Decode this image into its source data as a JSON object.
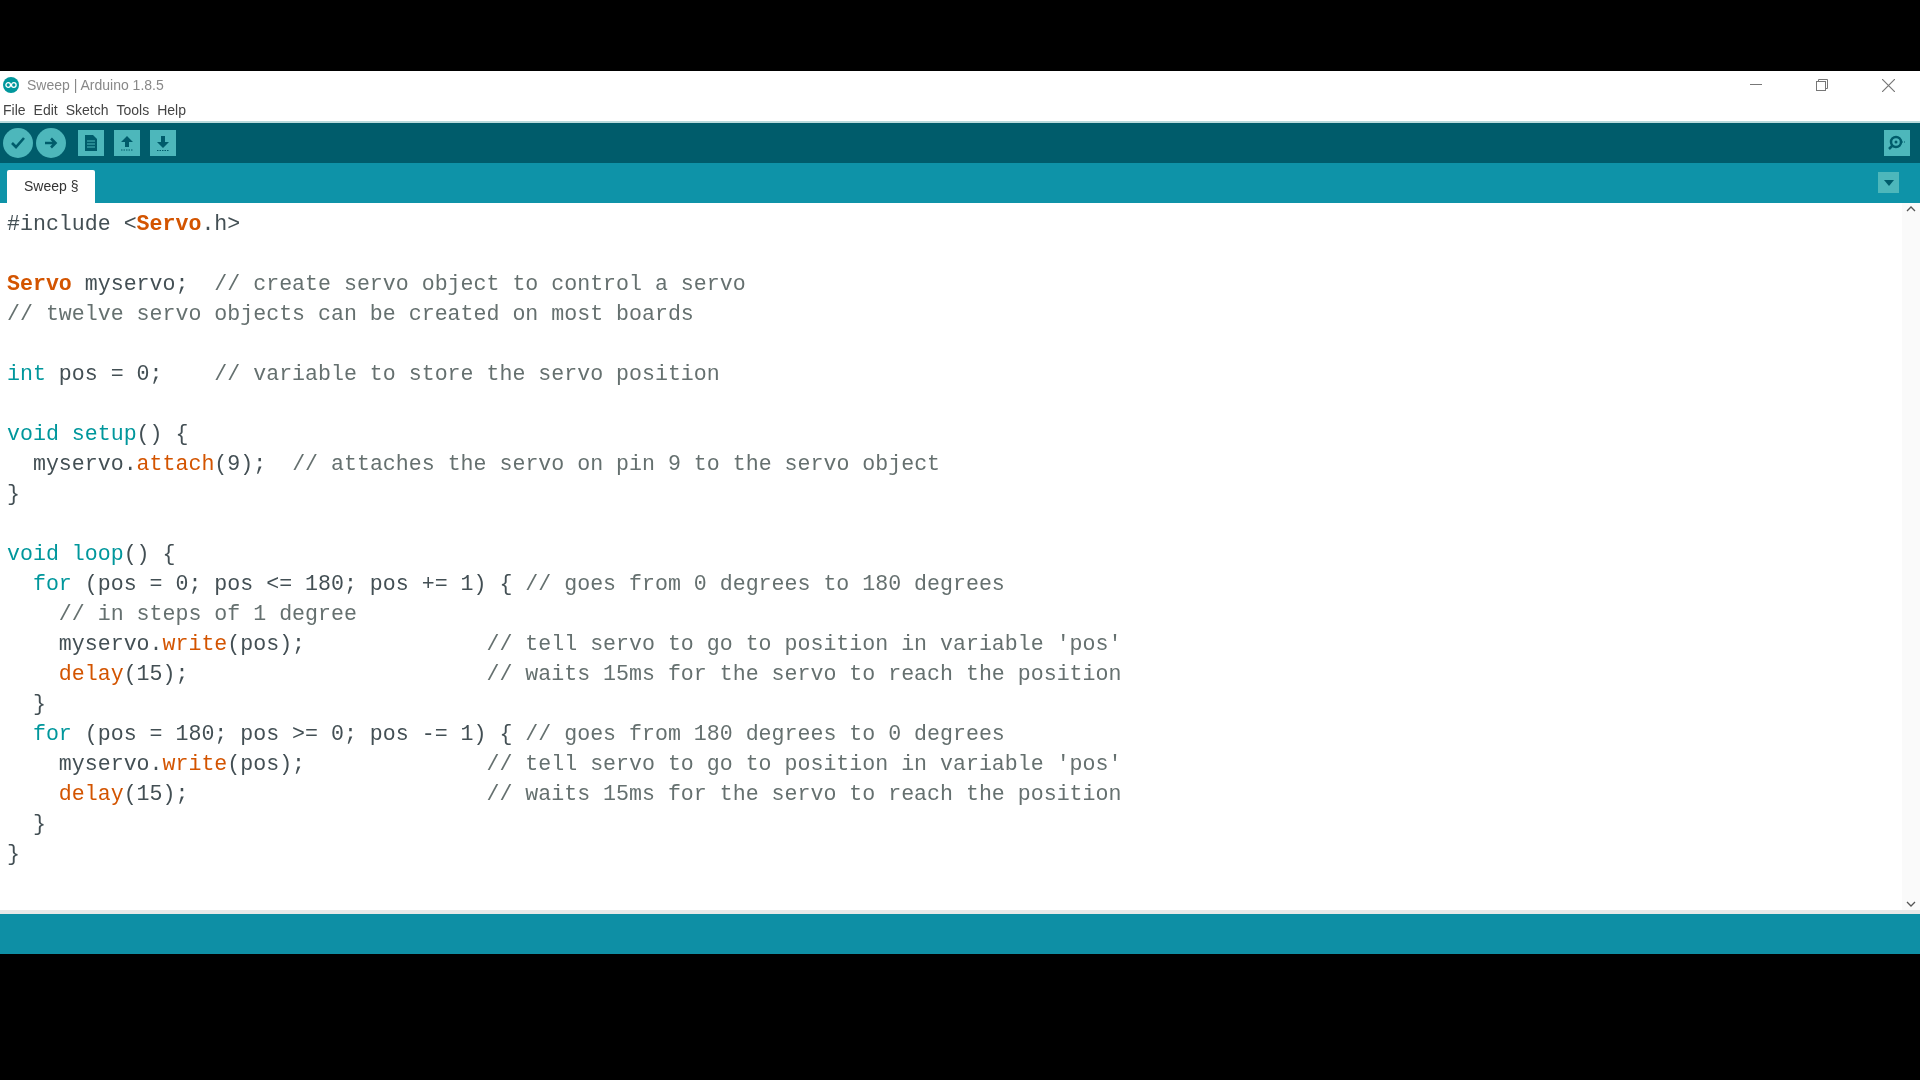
{
  "window": {
    "title": "Sweep | Arduino 1.8.5"
  },
  "menu": [
    "File",
    "Edit",
    "Sketch",
    "Tools",
    "Help"
  ],
  "tabs": [
    {
      "label": "Sweep §",
      "selected": true
    }
  ],
  "code": [
    {
      "kind": "code",
      "tokens": [
        {
          "kind": "plain",
          "text": "#include <"
        },
        {
          "kind": "class",
          "text": "Servo"
        },
        {
          "kind": "plain",
          "text": ".h>"
        }
      ]
    },
    {
      "kind": "blank"
    },
    {
      "kind": "code",
      "tokens": [
        {
          "kind": "class",
          "text": "Servo"
        },
        {
          "kind": "plain",
          "text": " myservo;  "
        },
        {
          "kind": "comment",
          "text": "// create servo object to control a servo"
        }
      ]
    },
    {
      "kind": "code",
      "tokens": [
        {
          "kind": "comment",
          "text": "// twelve servo objects can be created on most boards"
        }
      ]
    },
    {
      "kind": "blank"
    },
    {
      "kind": "code",
      "tokens": [
        {
          "kind": "keyword",
          "text": "int"
        },
        {
          "kind": "plain",
          "text": " pos = 0;    "
        },
        {
          "kind": "comment",
          "text": "// variable to store the servo position"
        }
      ]
    },
    {
      "kind": "blank"
    },
    {
      "kind": "code",
      "tokens": [
        {
          "kind": "keyword",
          "text": "void setup"
        },
        {
          "kind": "plain",
          "text": "() {"
        }
      ]
    },
    {
      "kind": "code",
      "tokens": [
        {
          "kind": "plain",
          "text": "  myservo."
        },
        {
          "kind": "function",
          "text": "attach"
        },
        {
          "kind": "plain",
          "text": "(9);  "
        },
        {
          "kind": "comment",
          "text": "// attaches the servo on pin 9 to the servo object"
        }
      ]
    },
    {
      "kind": "code",
      "tokens": [
        {
          "kind": "plain",
          "text": "}"
        }
      ]
    },
    {
      "kind": "blank"
    },
    {
      "kind": "code",
      "tokens": [
        {
          "kind": "keyword",
          "text": "void loop"
        },
        {
          "kind": "plain",
          "text": "() {"
        }
      ]
    },
    {
      "kind": "code",
      "tokens": [
        {
          "kind": "keyword",
          "text": "  for"
        },
        {
          "kind": "plain",
          "text": " (pos = 0; pos <= 180; pos += 1) { "
        },
        {
          "kind": "comment",
          "text": "// goes from 0 degrees to 180 degrees"
        }
      ]
    },
    {
      "kind": "code",
      "tokens": [
        {
          "kind": "comment",
          "text": "    // in steps of 1 degree"
        }
      ]
    },
    {
      "kind": "code",
      "tokens": [
        {
          "kind": "plain",
          "text": "    myservo."
        },
        {
          "kind": "function",
          "text": "write"
        },
        {
          "kind": "plain",
          "text": "(pos);              "
        },
        {
          "kind": "comment",
          "text": "// tell servo to go to position in variable 'pos'"
        }
      ]
    },
    {
      "kind": "code",
      "tokens": [
        {
          "kind": "function",
          "text": "    delay"
        },
        {
          "kind": "plain",
          "text": "(15);                       "
        },
        {
          "kind": "comment",
          "text": "// waits 15ms for the servo to reach the position"
        }
      ]
    },
    {
      "kind": "code",
      "tokens": [
        {
          "kind": "plain",
          "text": "  }"
        }
      ]
    },
    {
      "kind": "code",
      "tokens": [
        {
          "kind": "keyword",
          "text": "  for"
        },
        {
          "kind": "plain",
          "text": " (pos = 180; pos >= 0; pos -= 1) { "
        },
        {
          "kind": "comment",
          "text": "// goes from 180 degrees to 0 degrees"
        }
      ]
    },
    {
      "kind": "code",
      "tokens": [
        {
          "kind": "plain",
          "text": "    myservo."
        },
        {
          "kind": "function",
          "text": "write"
        },
        {
          "kind": "plain",
          "text": "(pos);              "
        },
        {
          "kind": "comment",
          "text": "// tell servo to go to position in variable 'pos'"
        }
      ]
    },
    {
      "kind": "code",
      "tokens": [
        {
          "kind": "function",
          "text": "    delay"
        },
        {
          "kind": "plain",
          "text": "(15);                       "
        },
        {
          "kind": "comment",
          "text": "// waits 15ms for the servo to reach the position"
        }
      ]
    },
    {
      "kind": "code",
      "tokens": [
        {
          "kind": "plain",
          "text": "  }"
        }
      ]
    },
    {
      "kind": "code",
      "tokens": [
        {
          "kind": "plain",
          "text": "}"
        }
      ]
    }
  ]
}
